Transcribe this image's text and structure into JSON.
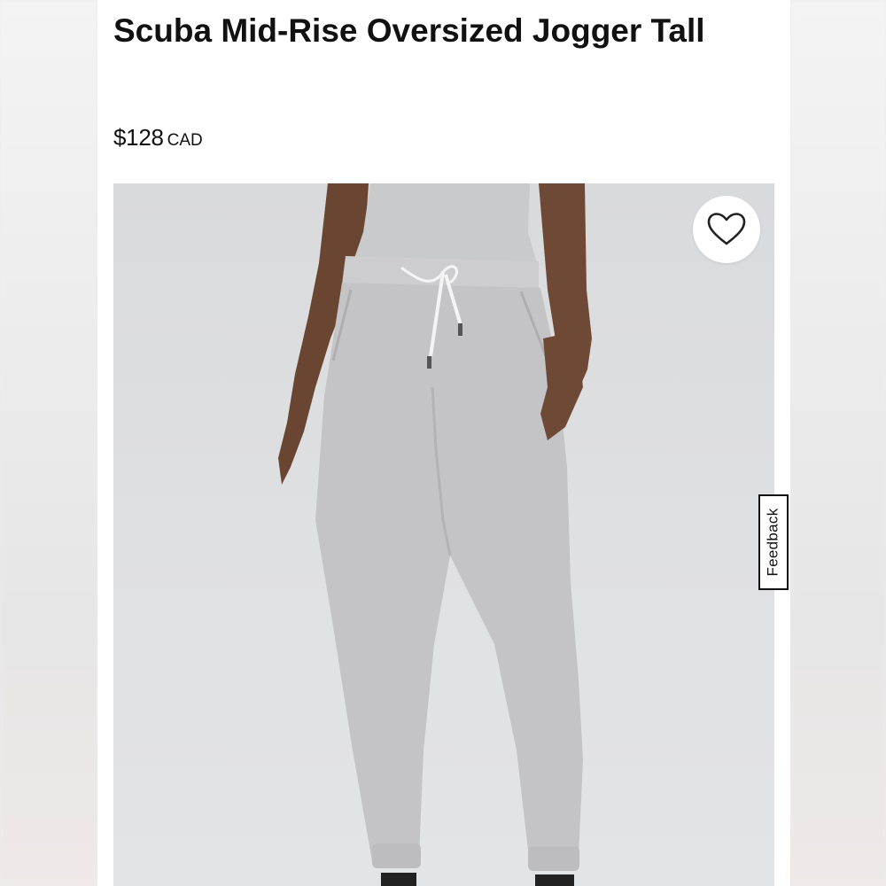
{
  "product": {
    "title": "Scuba Mid-Rise Oversized Jogger Tall",
    "price_amount": "$128",
    "price_currency": "CAD"
  },
  "image": {
    "subject": "heather grey oversized jogger",
    "wishlist_icon": "heart-icon"
  },
  "feedback": {
    "label": "Feedback"
  },
  "colors": {
    "text": "#111111",
    "card_bg": "#ffffff",
    "image_bg": "#dcdddf",
    "pants": "#c4c4c6"
  }
}
